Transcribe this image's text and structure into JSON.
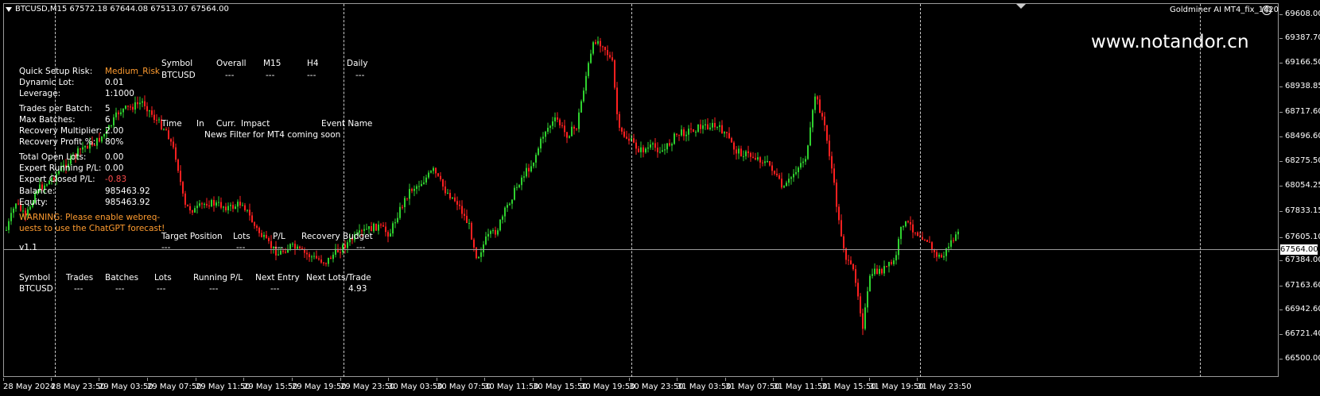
{
  "symbol_header": "BTCUSD,M15  67572.18 67644.08 67513.07 67564.00",
  "ea_name": "Goldminer AI MT4_fix_1420",
  "watermark": "www.notandor.cn",
  "current_price": "67564.00",
  "y_axis_ticks": [
    "69608.00",
    "69387.70",
    "69166.50",
    "68938.85",
    "68717.60",
    "68496.60",
    "68275.50",
    "68054.25",
    "67833.15",
    "67605.10",
    "67384.00",
    "67163.60",
    "66942.60",
    "66721.40",
    "66500.00"
  ],
  "x_axis_ticks": [
    "28 May 2024",
    "28 May 23:50",
    "29 May 03:50",
    "29 May 07:50",
    "29 May 11:50",
    "29 May 15:50",
    "29 May 19:50",
    "29 May 23:50",
    "30 May 03:50",
    "30 May 07:50",
    "30 May 11:50",
    "30 May 15:50",
    "30 May 19:50",
    "30 May 23:50",
    "31 May 03:50",
    "31 May 07:50",
    "31 May 11:50",
    "31 May 15:50",
    "31 May 19:50",
    "31 May 23:50"
  ],
  "settings_panel": {
    "rows": [
      {
        "label": "Quick Setup Risk:",
        "value": "Medium_Risk",
        "value_color": "#ff9c30"
      },
      {
        "label": "Dynamic Lot:",
        "value": "0.01"
      },
      {
        "label": "Leverage:",
        "value": "1:1000"
      },
      {
        "label": "Trades per Batch:",
        "value": "5"
      },
      {
        "label": "Max Batches:",
        "value": "6"
      },
      {
        "label": "Recovery Multiplier:",
        "value": "2.00"
      },
      {
        "label": "Recovery Profit %:",
        "value": "80%"
      },
      {
        "label": "Total Open Lots:",
        "value": "0.00"
      },
      {
        "label": "Expert Running P/L:",
        "value": "0.00"
      },
      {
        "label": "Expert Closed P/L:",
        "value": "-0.83",
        "value_color": "#ff4c4c"
      },
      {
        "label": "Balance:",
        "value": "985463.92"
      },
      {
        "label": "Equity:",
        "value": "985463.92"
      }
    ],
    "warning_line1": "WARNING: Please enable webreq-",
    "warning_line2": "uests to use the ChatGPT forecast!",
    "version": "v1.1"
  },
  "forecast_table": {
    "headers": [
      "Symbol",
      "Overall",
      "M15",
      "H4",
      "Daily"
    ],
    "row": [
      "BTCUSD",
      "---",
      "---",
      "---",
      "---"
    ]
  },
  "news_table": {
    "headers": [
      "Time",
      "In",
      "Curr.",
      "Impact",
      "Event Name"
    ],
    "message": "News Filter for MT4 coming soon"
  },
  "recovery_table": {
    "headers": [
      "Target Position",
      "Lots",
      "P/L",
      "Recovery Budget"
    ],
    "row": [
      "---",
      "---",
      "---",
      "---"
    ]
  },
  "trades_table": {
    "headers": [
      "Symbol",
      "Trades",
      "Batches",
      "Lots",
      "Running P/L",
      "Next Entry",
      "Next Lots/Trade"
    ],
    "row": [
      "BTCUSD",
      "---",
      "---",
      "---",
      "---",
      "---",
      "4.93"
    ]
  },
  "colors": {
    "bull": "#2fd12f",
    "bear": "#ff2020",
    "background": "#000000",
    "warning": "#ff9c30"
  }
}
